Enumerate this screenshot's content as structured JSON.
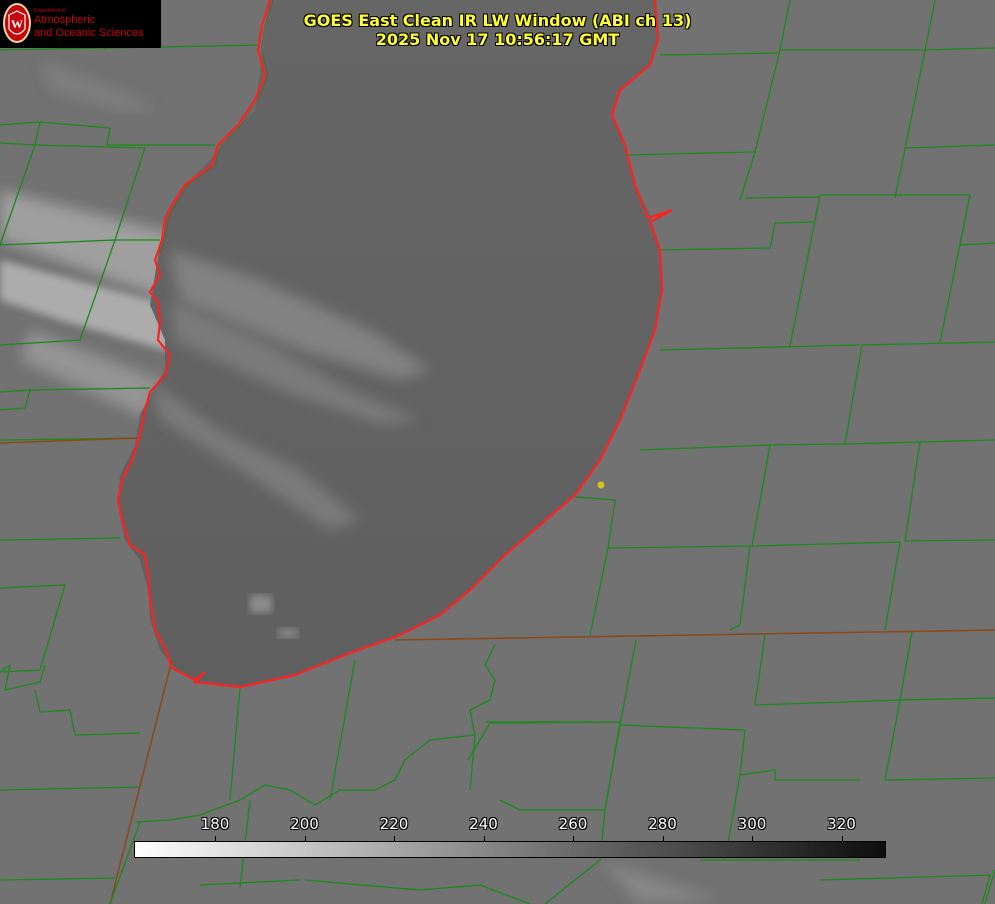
{
  "title": {
    "line1": "GOES East Clean IR LW Window (ABI ch 13)",
    "line2": "2025 Nov 17 10:56:17 GMT"
  },
  "logo": {
    "dept": "Department of",
    "line1": "Atmospheric",
    "line2": "and Oceanic Sciences",
    "crest_letter": "W"
  },
  "colorbar": {
    "ticks": [
      "180",
      "200",
      "220",
      "240",
      "260",
      "280",
      "300",
      "320"
    ]
  },
  "colors": {
    "title_text": "#ffff33",
    "boundary_lines": "#1a8a1a",
    "coastline": "#ff2020",
    "marker": "#d4c21a",
    "logo_red": "#c5050c"
  }
}
